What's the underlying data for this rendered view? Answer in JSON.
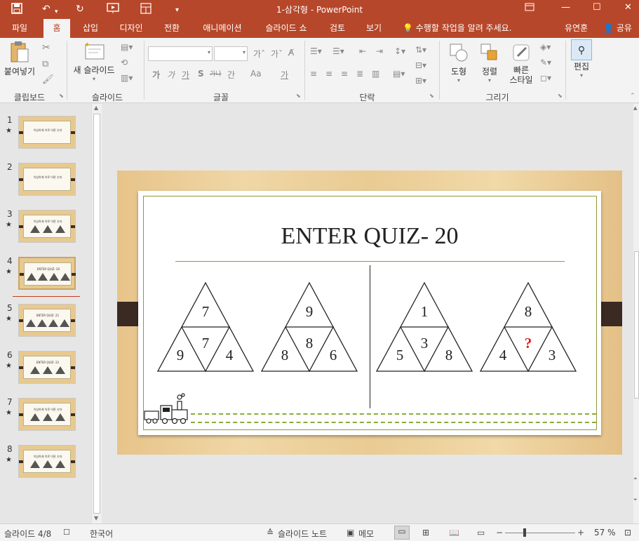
{
  "window": {
    "title": "1-삼각형 - PowerPoint",
    "quick_access": [
      "save-icon",
      "undo-icon",
      "redo-icon",
      "from-beginning-icon",
      "layout-icon",
      "customize-icon"
    ],
    "controls": [
      "minimize-icon",
      "restore-icon",
      "maximize-icon",
      "close-icon"
    ]
  },
  "tabs": [
    {
      "label": "파일"
    },
    {
      "label": "홈",
      "active": true
    },
    {
      "label": "삽입"
    },
    {
      "label": "디자인"
    },
    {
      "label": "전환"
    },
    {
      "label": "애니메이션"
    },
    {
      "label": "슬라이드 쇼"
    },
    {
      "label": "검토"
    },
    {
      "label": "보기"
    }
  ],
  "tellme": "수행할 작업을 알려 주세요.",
  "user": "유연훈",
  "share": "공유",
  "ribbon": {
    "paste_label": "붙여넣기",
    "new_slide_label": "새 슬라이드",
    "shapes_label": "도형",
    "arrange_label": "정렬",
    "quick_styles_label": "빠른 스타일",
    "quick_styles_line1": "빠른",
    "quick_styles_line2": "스타일",
    "edit_label": "편집",
    "font_buttons": [
      "가",
      "가",
      "가",
      "S",
      "가나",
      "간",
      "Aa",
      "가"
    ],
    "groups": [
      "클립보드",
      "슬라이드",
      "글꼴",
      "단락",
      "그리기"
    ]
  },
  "thumbnails": [
    {
      "num": "1",
      "star": "★",
      "title": "이상하게 이로 이룬 숫자"
    },
    {
      "num": "2",
      "star": "",
      "title": "이상하게 이로 이룬 숫자"
    },
    {
      "num": "3",
      "star": "★",
      "title": "이상하게 이로 이룬 숫자"
    },
    {
      "num": "4",
      "star": "★",
      "title": "ENTER QUIZ- 20"
    },
    {
      "num": "5",
      "star": "★",
      "title": "ENTER QUIZ- 21"
    },
    {
      "num": "6",
      "star": "★",
      "title": "ENTER QUIZ- 22"
    },
    {
      "num": "7",
      "star": "★",
      "title": "이상하게 이로 이룬 숫자"
    },
    {
      "num": "8",
      "star": "★",
      "title": "이상하게 이로 이룬 숫자"
    }
  ],
  "slide": {
    "title": "ENTER QUIZ- 20",
    "triangles": [
      {
        "top": "7",
        "center": "7",
        "left": "9",
        "right": "4"
      },
      {
        "top": "9",
        "center": "8",
        "left": "8",
        "right": "6"
      },
      {
        "top": "1",
        "center": "3",
        "left": "5",
        "right": "8"
      },
      {
        "top": "8",
        "center": "?",
        "left": "4",
        "right": "3"
      }
    ]
  },
  "status": {
    "slide_info": "슬라이드 4/8",
    "language": "한국어",
    "notes": "슬라이드 노트",
    "comments": "메모",
    "zoom": "57 %",
    "zoom_minus": "−",
    "zoom_plus": "+"
  },
  "colors": {
    "accent": "#b7472a",
    "paper_frame": "#8a9a3a",
    "question": "#d9211a"
  }
}
